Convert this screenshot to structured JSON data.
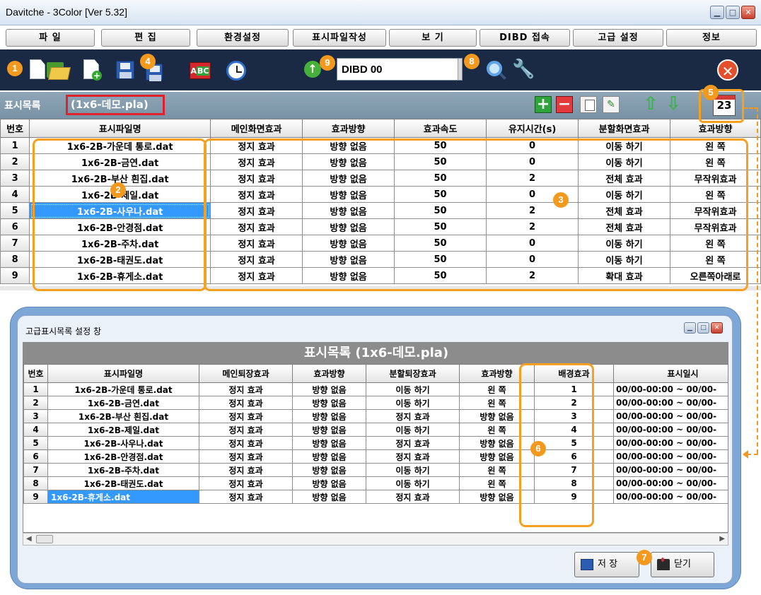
{
  "window": {
    "title": "Davitche - 3Color [Ver 5.32]"
  },
  "menu": [
    "파   일",
    "편   집",
    "환경설정",
    "표시파일작성",
    "보   기",
    "DIBD 접속",
    "고급 설정",
    "정보"
  ],
  "toolbar": {
    "device_combo_value": "DIBD 00",
    "icons": [
      "new-file-icon",
      "open-folder-icon",
      "new-file-plus-icon",
      "save-icon",
      "save-as-icon",
      "abc-font-icon",
      "schedule-clock-icon",
      "upload-arrow-icon",
      "search-icon",
      "wrench-icon",
      "close-icon"
    ]
  },
  "list": {
    "title": "표시목록",
    "file": "(1x6-데모.pla)",
    "calendar_day": "23"
  },
  "main_table": {
    "headers": [
      "번호",
      "표시파일명",
      "메인화면효과",
      "효과방향",
      "효과속도",
      "유지시간(s)",
      "분할화면효과",
      "효과방향"
    ],
    "selected_row": 5,
    "rows": [
      [
        "1",
        "1x6-2B-가운데 통로.dat",
        "정지 효과",
        "방향 없음",
        "50",
        "0",
        "이동 하기",
        "왼          쪽"
      ],
      [
        "2",
        "1x6-2B-금연.dat",
        "정지 효과",
        "방향 없음",
        "50",
        "0",
        "이동 하기",
        "왼          쪽"
      ],
      [
        "3",
        "1x6-2B-부산 흰집.dat",
        "정지 효과",
        "방향 없음",
        "50",
        "2",
        "전체 효과",
        "무작위효과"
      ],
      [
        "4",
        "1x6-2B-제일.dat",
        "정지 효과",
        "방향 없음",
        "50",
        "0",
        "이동 하기",
        "왼          쪽"
      ],
      [
        "5",
        "1x6-2B-사우나.dat",
        "정지 효과",
        "방향 없음",
        "50",
        "2",
        "전체 효과",
        "무작위효과"
      ],
      [
        "6",
        "1x6-2B-안경점.dat",
        "정지 효과",
        "방향 없음",
        "50",
        "2",
        "전체 효과",
        "무작위효과"
      ],
      [
        "7",
        "1x6-2B-주차.dat",
        "정지 효과",
        "방향 없음",
        "50",
        "0",
        "이동 하기",
        "왼          쪽"
      ],
      [
        "8",
        "1x6-2B-태권도.dat",
        "정지 효과",
        "방향 없음",
        "50",
        "0",
        "이동 하기",
        "왼          쪽"
      ],
      [
        "9",
        "1x6-2B-휴게소.dat",
        "정지 효과",
        "방향 없음",
        "50",
        "2",
        "확대 효과",
        "오른쪽아래로"
      ]
    ]
  },
  "badges": [
    "1",
    "2",
    "3",
    "4",
    "5",
    "6",
    "7",
    "8",
    "9"
  ],
  "dialog": {
    "title": "고급표시목록 설정 창",
    "header": "표시목록 (1x6-데모.pla)",
    "headers": [
      "번호",
      "표시파일명",
      "메인퇴장효과",
      "효과방향",
      "분할퇴장효과",
      "효과방향",
      "배경효과",
      "표시일시"
    ],
    "selected_row": 9,
    "rows": [
      [
        "1",
        "1x6-2B-가운데 통로.dat",
        "정지 효과",
        "방향 없음",
        "이동 하기",
        "왼        쪽",
        "1",
        "00/00-00:00 ~ 00/00-"
      ],
      [
        "2",
        "1x6-2B-금연.dat",
        "정지 효과",
        "방향 없음",
        "이동 하기",
        "왼        쪽",
        "2",
        "00/00-00:00 ~ 00/00-"
      ],
      [
        "3",
        "1x6-2B-부산 흰집.dat",
        "정지 효과",
        "방향 없음",
        "정지 효과",
        "방향 없음",
        "3",
        "00/00-00:00 ~ 00/00-"
      ],
      [
        "4",
        "1x6-2B-제일.dat",
        "정지 효과",
        "방향 없음",
        "이동 하기",
        "왼        쪽",
        "4",
        "00/00-00:00 ~ 00/00-"
      ],
      [
        "5",
        "1x6-2B-사우나.dat",
        "정지 효과",
        "방향 없음",
        "정지 효과",
        "방향 없음",
        "5",
        "00/00-00:00 ~ 00/00-"
      ],
      [
        "6",
        "1x6-2B-안경점.dat",
        "정지 효과",
        "방향 없음",
        "정지 효과",
        "방향 없음",
        "6",
        "00/00-00:00 ~ 00/00-"
      ],
      [
        "7",
        "1x6-2B-주차.dat",
        "정지 효과",
        "방향 없음",
        "이동 하기",
        "왼        쪽",
        "7",
        "00/00-00:00 ~ 00/00-"
      ],
      [
        "8",
        "1x6-2B-태권도.dat",
        "정지 효과",
        "방향 없음",
        "이동 하기",
        "왼        쪽",
        "8",
        "00/00-00:00 ~ 00/00-"
      ],
      [
        "9",
        "1x6-2B-휴게소.dat",
        "정지 효과",
        "방향 없음",
        "정지 효과",
        "방향 없음",
        "9",
        "00/00-00:00 ~ 00/00-"
      ]
    ],
    "save_label": "저   장",
    "close_label": "닫기"
  },
  "colors": {
    "accent_orange": "#f39a1e",
    "highlight_red": "#e0202a",
    "selection_blue": "#3399ff",
    "toolbar_navy": "#1a2a44"
  }
}
